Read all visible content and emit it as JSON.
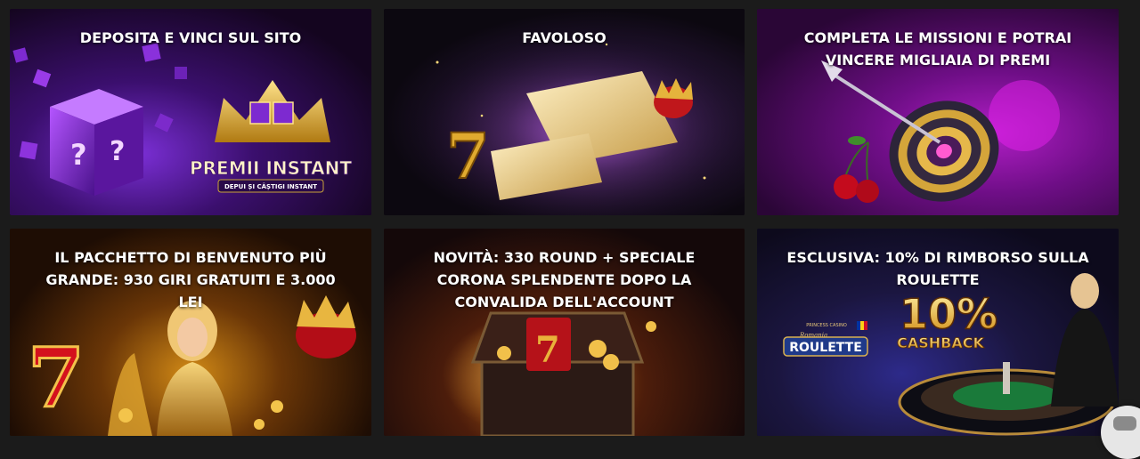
{
  "promotions": [
    {
      "title": "DEPOSITA E VINCI SUL SITO",
      "art_text": {
        "headline": "PREMII INSTANT",
        "subline": "DEPUI ȘI CÂȘTIGI INSTANT"
      }
    },
    {
      "title": "FAVOLOSO"
    },
    {
      "title": "COMPLETA LE MISSIONI E POTRAI VINCERE MIGLIAIA DI PREMI"
    },
    {
      "title": "IL PACCHETTO DI BENVENUTO PIÙ GRANDE: 930 GIRI GRATUITI E 3.000 LEI"
    },
    {
      "title": "NOVITÀ: 330 ROUND + SPECIALE CORONA SPLENDENTE DOPO LA CONVALIDA DELL'ACCOUNT"
    },
    {
      "title": "ESCLUSIVA: 10% DI RIMBORSO SULLA ROULETTE",
      "art_text": {
        "percent": "10%",
        "cashback": "CASHBACK",
        "brand_top": "PRINCESS CASINO",
        "brand_mid": "Romania",
        "roulette": "ROULETTE"
      }
    }
  ],
  "chat_widget": {
    "icon": "chat-bubble-icon"
  }
}
